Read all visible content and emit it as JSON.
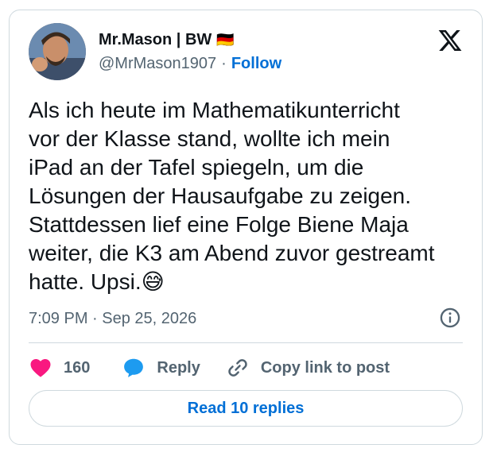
{
  "tweet": {
    "author_name": "Mr.Mason | BW",
    "author_badge": "🇩🇪",
    "handle": "@MrMason1907",
    "separator": "·",
    "follow_label": "Follow",
    "text": "Als ich heute im Mathematikunterricht\nvor der Klasse stand, wollte ich mein\niPad an der Tafel spiegeln, um die\nLösungen der Hausaufgabe zu zeigen.\nStattdessen lief eine Folge Biene Maja\nweiter, die K3 am Abend zuvor gestreamt\nhatte. Upsi.😅",
    "timestamp": "7:09 PM · Sep 25, 2026"
  },
  "actions": {
    "like_count": "160",
    "reply_label": "Reply",
    "copy_link_label": "Copy link to post"
  },
  "read_replies_label": "Read 10 replies",
  "colors": {
    "like": "#f91880",
    "reply": "#1d9bf0",
    "link": "#006fd6",
    "muted": "#536471"
  },
  "icons": [
    "x-logo-icon",
    "info-icon",
    "heart-icon",
    "reply-bubble-icon",
    "link-icon"
  ]
}
